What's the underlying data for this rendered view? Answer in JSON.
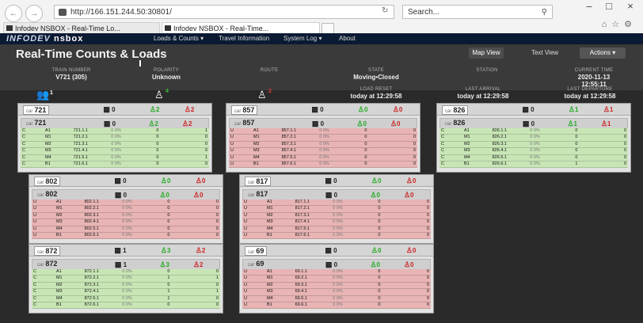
{
  "browser": {
    "url": "http://166.151.244.50:30801/",
    "search_placeholder": "Search...",
    "tabs": [
      "Infodev NSBOX - Real-Time Lo...",
      "Infodev NSBOX - Real-Time..."
    ],
    "refresh_icon": "refresh-icon",
    "search_icon": "search-icon"
  },
  "app": {
    "logo_prefix": "INFODEV",
    "logo_name": "nsbox",
    "nav": [
      "Loads & Counts ▾",
      "Travel Information",
      "System Log ▾",
      "About"
    ],
    "title": "Real-Time Counts & Loads",
    "subtitle": "",
    "buttons": {
      "map_view": "Map View",
      "text_view": "Text View",
      "actions": "Actions ▾"
    },
    "info": {
      "train_number_label": "TRAIN NUMBER",
      "train_number": "V721 (305)",
      "polarity_label": "POLARITY",
      "polarity": "Unknown",
      "route_label": "ROUTE",
      "route": "",
      "state_label": "STATE",
      "state": "Moving•Closed",
      "station_label": "STATION",
      "station": "",
      "current_time_label": "CURRENT TIME",
      "current_date": "2020-11-13",
      "current_time": "12:55:11",
      "load_reset_label": "LOAD RESET",
      "load_reset": "today at 12:29:58",
      "last_arrival_label": "LAST ARRIVAL",
      "last_arrival": "today at 12:29:58",
      "last_departure_label": "LAST DEPARTURE",
      "last_departure": "today at 12:29:58"
    },
    "summary": {
      "people": "1",
      "on": "4",
      "off": "2"
    },
    "colors": {
      "green": "#c8e6b5",
      "red": "#e8b4b4",
      "on": "#39c03b",
      "off": "#e23a3a"
    },
    "cars": [
      {
        "car": "721",
        "pax": "0",
        "on": "2",
        "off": "2",
        "sub": {
          "car": "721",
          "pax": "0",
          "on": "2",
          "off": "2"
        },
        "rows": [
          {
            "st": "C",
            "door": "A1",
            "id": "721.1.1",
            "lbl": "0 0%",
            "n1": "0",
            "n2": "1",
            "c": "g"
          },
          {
            "st": "C",
            "door": "M1",
            "id": "721.2.1",
            "lbl": "0 0%",
            "n1": "0",
            "n2": "0",
            "c": "g"
          },
          {
            "st": "C",
            "door": "M2",
            "id": "721.3.1",
            "lbl": "0 0%",
            "n1": "0",
            "n2": "0",
            "c": "g"
          },
          {
            "st": "C",
            "door": "M3",
            "id": "721.4.1",
            "lbl": "0 0%",
            "n1": "0",
            "n2": "0",
            "c": "g"
          },
          {
            "st": "C",
            "door": "M4",
            "id": "721.5.1",
            "lbl": "0 0%",
            "n1": "0",
            "n2": "1",
            "c": "g"
          },
          {
            "st": "C",
            "door": "B1",
            "id": "721.6.1",
            "lbl": "0 0%",
            "n1": "0",
            "n2": "0",
            "c": "g"
          }
        ]
      },
      {
        "car": "857",
        "pax": "0",
        "on": "0",
        "off": "0",
        "sub": {
          "car": "857",
          "pax": "0",
          "on": "0",
          "off": "0"
        },
        "rows": [
          {
            "st": "U",
            "door": "A1",
            "id": "857.1.1",
            "lbl": "0 0%",
            "n1": "0",
            "n2": "0",
            "c": "r"
          },
          {
            "st": "U",
            "door": "M1",
            "id": "857.2.1",
            "lbl": "0 0%",
            "n1": "0",
            "n2": "0",
            "c": "r"
          },
          {
            "st": "U",
            "door": "M2",
            "id": "857.3.1",
            "lbl": "0 0%",
            "n1": "0",
            "n2": "0",
            "c": "r"
          },
          {
            "st": "U",
            "door": "M3",
            "id": "857.4.1",
            "lbl": "0 0%",
            "n1": "0",
            "n2": "0",
            "c": "r"
          },
          {
            "st": "U",
            "door": "M4",
            "id": "857.5.1",
            "lbl": "0 0%",
            "n1": "0",
            "n2": "0",
            "c": "r"
          },
          {
            "st": "U",
            "door": "B1",
            "id": "857.6.1",
            "lbl": "0 0%",
            "n1": "0",
            "n2": "0",
            "c": "r"
          }
        ]
      },
      {
        "car": "826",
        "pax": "0",
        "on": "1",
        "off": "1",
        "sub": {
          "car": "826",
          "pax": "0",
          "on": "1",
          "off": "1"
        },
        "rows": [
          {
            "st": "C",
            "door": "A1",
            "id": "826.1.1",
            "lbl": "0 0%",
            "n1": "0",
            "n2": "0",
            "c": "g"
          },
          {
            "st": "C",
            "door": "M1",
            "id": "826.2.1",
            "lbl": "0 0%",
            "n1": "0",
            "n2": "0",
            "c": "g"
          },
          {
            "st": "C",
            "door": "M2",
            "id": "826.3.1",
            "lbl": "0 0%",
            "n1": "0",
            "n2": "0",
            "c": "g"
          },
          {
            "st": "C",
            "door": "M3",
            "id": "826.4.1",
            "lbl": "0 0%",
            "n1": "0",
            "n2": "0",
            "c": "g"
          },
          {
            "st": "C",
            "door": "M4",
            "id": "826.5.1",
            "lbl": "0 0%",
            "n1": "0",
            "n2": "0",
            "c": "g"
          },
          {
            "st": "C",
            "door": "B1",
            "id": "826.6.1",
            "lbl": "0 0%",
            "n1": "1",
            "n2": "0",
            "c": "g"
          }
        ]
      },
      {
        "car": "802",
        "pax": "0",
        "on": "0",
        "off": "0",
        "sub": {
          "car": "802",
          "pax": "0",
          "on": "0",
          "off": "0"
        },
        "rows": [
          {
            "st": "U",
            "door": "A1",
            "id": "802.1.1",
            "lbl": "0 0%",
            "n1": "0",
            "n2": "0",
            "c": "r"
          },
          {
            "st": "U",
            "door": "M1",
            "id": "802.2.1",
            "lbl": "0 0%",
            "n1": "0",
            "n2": "0",
            "c": "r"
          },
          {
            "st": "U",
            "door": "M2",
            "id": "802.3.1",
            "lbl": "0 0%",
            "n1": "0",
            "n2": "0",
            "c": "r"
          },
          {
            "st": "U",
            "door": "M3",
            "id": "802.4.1",
            "lbl": "0 0%",
            "n1": "0",
            "n2": "0",
            "c": "r"
          },
          {
            "st": "U",
            "door": "M4",
            "id": "802.5.1",
            "lbl": "0 0%",
            "n1": "0",
            "n2": "0",
            "c": "r"
          },
          {
            "st": "U",
            "door": "B1",
            "id": "802.6.1",
            "lbl": "0 0%",
            "n1": "0",
            "n2": "0",
            "c": "r"
          }
        ]
      },
      {
        "car": "817",
        "pax": "0",
        "on": "0",
        "off": "0",
        "sub": {
          "car": "817",
          "pax": "0",
          "on": "0",
          "off": "0"
        },
        "rows": [
          {
            "st": "U",
            "door": "A1",
            "id": "817.1.1",
            "lbl": "0 0%",
            "n1": "0",
            "n2": "0",
            "c": "r"
          },
          {
            "st": "U",
            "door": "M1",
            "id": "817.2.1",
            "lbl": "0 0%",
            "n1": "0",
            "n2": "0",
            "c": "r"
          },
          {
            "st": "U",
            "door": "M2",
            "id": "817.3.1",
            "lbl": "0 0%",
            "n1": "0",
            "n2": "0",
            "c": "r"
          },
          {
            "st": "U",
            "door": "M3",
            "id": "817.4.1",
            "lbl": "0 0%",
            "n1": "0",
            "n2": "0",
            "c": "r"
          },
          {
            "st": "U",
            "door": "M4",
            "id": "817.5.1",
            "lbl": "0 0%",
            "n1": "0",
            "n2": "0",
            "c": "r"
          },
          {
            "st": "U",
            "door": "B1",
            "id": "817.6.1",
            "lbl": "0 0%",
            "n1": "0",
            "n2": "0",
            "c": "r"
          }
        ]
      },
      {
        "car": "872",
        "pax": "1",
        "on": "3",
        "off": "2",
        "sub": {
          "car": "872",
          "pax": "1",
          "on": "3",
          "off": "2"
        },
        "rows": [
          {
            "st": "C",
            "door": "A1",
            "id": "872.1.1",
            "lbl": "0 0%",
            "n1": "0",
            "n2": "0",
            "c": "g"
          },
          {
            "st": "C",
            "door": "M1",
            "id": "872.2.1",
            "lbl": "0 0%",
            "n1": "1",
            "n2": "1",
            "c": "g"
          },
          {
            "st": "C",
            "door": "M2",
            "id": "872.3.1",
            "lbl": "0 0%",
            "n1": "0",
            "n2": "0",
            "c": "g"
          },
          {
            "st": "C",
            "door": "M3",
            "id": "872.4.1",
            "lbl": "0 0%",
            "n1": "1",
            "n2": "1",
            "c": "g"
          },
          {
            "st": "C",
            "door": "M4",
            "id": "872.5.1",
            "lbl": "0 0%",
            "n1": "1",
            "n2": "0",
            "c": "g"
          },
          {
            "st": "C",
            "door": "B1",
            "id": "872.6.1",
            "lbl": "0 0%",
            "n1": "0",
            "n2": "0",
            "c": "g"
          }
        ]
      },
      {
        "car": "69",
        "pax": "0",
        "on": "0",
        "off": "0",
        "sub": {
          "car": "69",
          "pax": "0",
          "on": "0",
          "off": "0"
        },
        "rows": [
          {
            "st": "U",
            "door": "A1",
            "id": "69.1.1",
            "lbl": "0 0%",
            "n1": "0",
            "n2": "0",
            "c": "r"
          },
          {
            "st": "U",
            "door": "M1",
            "id": "69.2.1",
            "lbl": "0 0%",
            "n1": "0",
            "n2": "0",
            "c": "r"
          },
          {
            "st": "U",
            "door": "M2",
            "id": "69.3.1",
            "lbl": "0 0%",
            "n1": "0",
            "n2": "0",
            "c": "r"
          },
          {
            "st": "U",
            "door": "M3",
            "id": "69.4.1",
            "lbl": "0 0%",
            "n1": "0",
            "n2": "0",
            "c": "r"
          },
          {
            "st": "U",
            "door": "M4",
            "id": "69.5.1",
            "lbl": "0 0%",
            "n1": "0",
            "n2": "0",
            "c": "r"
          },
          {
            "st": "U",
            "door": "B1",
            "id": "69.6.1",
            "lbl": "0 0%",
            "n1": "0",
            "n2": "0",
            "c": "r"
          }
        ]
      }
    ]
  }
}
